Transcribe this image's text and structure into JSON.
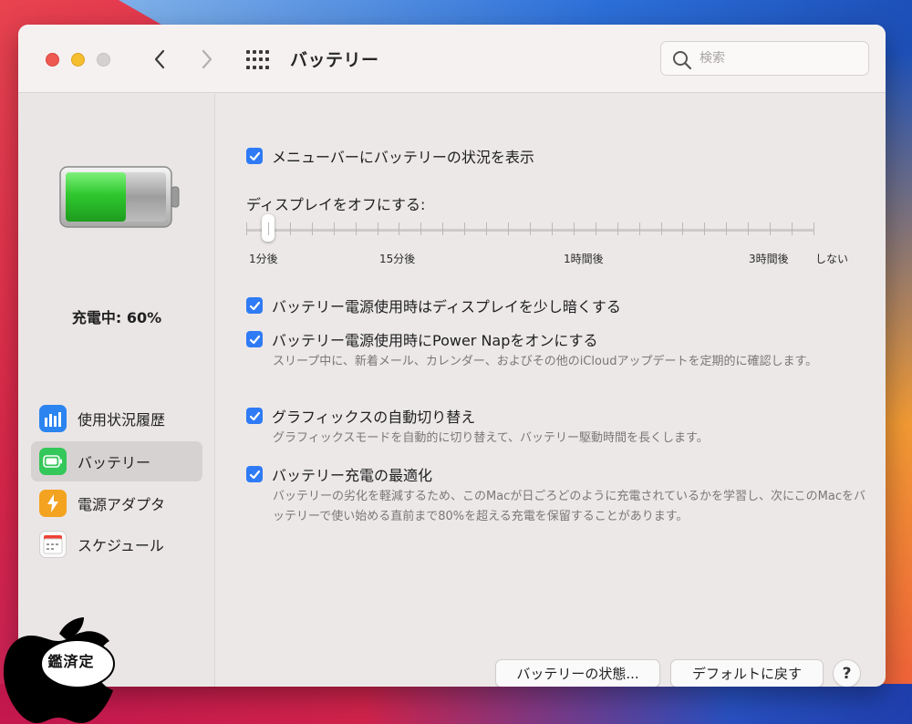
{
  "window": {
    "title": "バッテリー",
    "search_placeholder": "検索"
  },
  "sidebar": {
    "charging_status": "充電中: 60%",
    "battery_level_percent": 60,
    "items": [
      {
        "label": "使用状況履歴",
        "icon": "bar-chart-icon",
        "selected": false
      },
      {
        "label": "バッテリー",
        "icon": "battery-icon",
        "selected": true
      },
      {
        "label": "電源アダプタ",
        "icon": "lightning-icon",
        "selected": false
      },
      {
        "label": "スケジュール",
        "icon": "calendar-icon",
        "selected": false
      }
    ]
  },
  "settings": {
    "show_status": {
      "label": "メニューバーにバッテリーの状況を表示",
      "checked": true
    },
    "display_off": {
      "label": "ディスプレイをオフにする:",
      "tick_labels": [
        "1分後",
        "15分後",
        "1時間後",
        "3時間後",
        "しない"
      ]
    },
    "dim_display": {
      "label": "バッテリー電源使用時はディスプレイを少し暗くする",
      "checked": true
    },
    "power_nap": {
      "label": "バッテリー電源使用時にPower Napをオンにする",
      "checked": true,
      "description": "スリープ中に、新着メール、カレンダー、およびその他のiCloudアップデートを定期的に確認します。"
    },
    "graphics_switching": {
      "label": "グラフィックスの自動切り替え",
      "checked": true,
      "description": "グラフィックスモードを自動的に切り替えて、バッテリー駆動時間を長くします。"
    },
    "optimized_charging": {
      "label": "バッテリー充電の最適化",
      "checked": true,
      "description": "バッテリーの劣化を軽減するため、このMacが日ごろどのように充電されているかを学習し、次にこのMacをバッテリーで使い始める直前まで80%を超える充電を保留することがあります。"
    }
  },
  "buttons": {
    "battery_health": "バッテリーの状態...",
    "restore_defaults": "デフォルトに戻す",
    "help": "?"
  },
  "watermark": {
    "text": "鑑済定"
  },
  "colors": {
    "accent": "#2f7bf5",
    "battery_fill": "#2fc82f",
    "close": "#ee5a52",
    "minimize": "#f5be2f"
  }
}
